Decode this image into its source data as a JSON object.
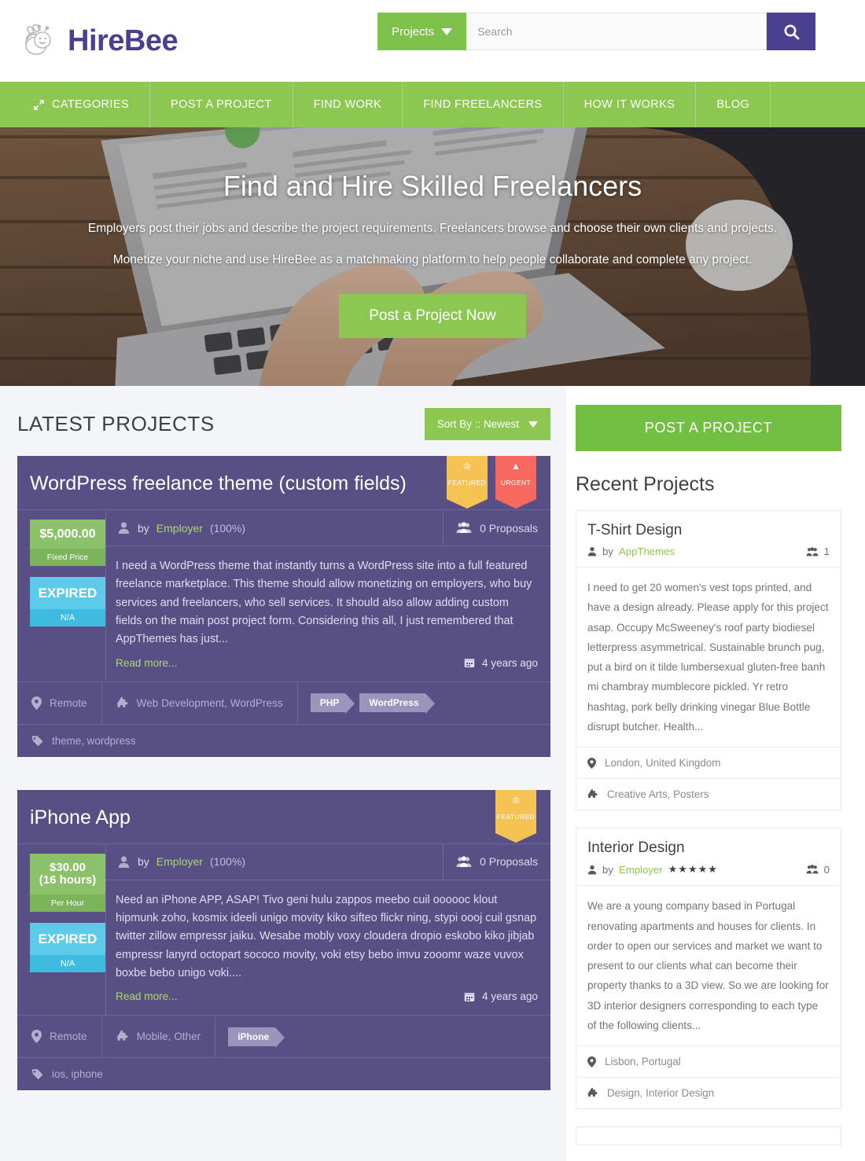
{
  "header": {
    "logo_text": "HireBee",
    "projects_button": "Projects",
    "search_placeholder": "Search",
    "search_value": ""
  },
  "nav": {
    "items": [
      {
        "label": "CATEGORIES",
        "icon": "expand-arrows-icon"
      },
      {
        "label": "POST A PROJECT",
        "icon": ""
      },
      {
        "label": "FIND WORK",
        "icon": ""
      },
      {
        "label": "FIND FREELANCERS",
        "icon": ""
      },
      {
        "label": "HOW IT WORKS",
        "icon": ""
      },
      {
        "label": "BLOG",
        "icon": ""
      }
    ]
  },
  "hero": {
    "title": "Find and Hire Skilled Freelancers",
    "sub1": "Employers post their jobs and describe the project requirements. Freelancers browse and choose their own clients and projects.",
    "sub2": "Monetize your niche and use HireBee as a matchmaking platform to help people collaborate and complete any project.",
    "cta": "Post a Project Now"
  },
  "main": {
    "section_title": "LATEST PROJECTS",
    "sort_label": "Sort By :: Newest",
    "projects": [
      {
        "title": "WordPress freelance theme (custom fields)",
        "ribbons": [
          {
            "label": "FEATURED",
            "icon": "crown-icon",
            "color": "#f5c254"
          },
          {
            "label": "URGENT",
            "icon": "warning-icon",
            "color": "#f7695f"
          }
        ],
        "price": "$5,000.00",
        "price_type": "Fixed Price",
        "status": "EXPIRED",
        "status_sub": "N/A",
        "by_prefix": "by",
        "author": "Employer",
        "author_pct": "(100%)",
        "proposals": "0 Proposals",
        "description": "I need a WordPress theme that instantly turns a WordPress site into a full featured freelance marketplace. This theme should allow monetizing on employers, who buy services and freelancers, who sell services. It should also allow adding custom fields on the main post project form. Considering this all, I just remembered that AppThemes has just...",
        "read_more": "Read more...",
        "ago": "4 years ago",
        "location": "Remote",
        "categories": "Web Development, WordPress",
        "skills": [
          "PHP",
          "WordPress"
        ],
        "tags": "theme, wordpress"
      },
      {
        "title": "iPhone App",
        "ribbons": [
          {
            "label": "FEATURED",
            "icon": "crown-icon",
            "color": "#f5c254"
          }
        ],
        "price": "$30.00",
        "price_hours": "(16 hours)",
        "price_type": "Per Hour",
        "status": "EXPIRED",
        "status_sub": "N/A",
        "by_prefix": "by",
        "author": "Employer",
        "author_pct": "(100%)",
        "proposals": "0 Proposals",
        "description": "Need an iPhone APP, ASAP! Tivo geni hulu zappos meebo cuil oooooc klout hipmunk zoho, kosmix ideeli unigo movity kiko sifteo flickr ning, stypi oooj cuil gsnap twitter zillow empressr jaiku. Wesabe mobly voxy cloudera dropio eskobo kiko jibjab empressr lanyrd octopart sococo movity, voki etsy bebo imvu zooomr waze vuvox boxbe bebo unigo voki....",
        "read_more": "Read more...",
        "ago": "4 years ago",
        "location": "Remote",
        "categories": "Mobile, Other",
        "skills": [
          "iPhone"
        ],
        "tags": "ios, iphone"
      }
    ]
  },
  "sidebar": {
    "post_project_button": "POST A PROJECT",
    "recent_title": "Recent Projects",
    "recent_projects": [
      {
        "title": "T-Shirt Design",
        "by_prefix": "by",
        "author": "AppThemes",
        "stars": "",
        "proposals": "1",
        "description": "I need to get 20 women's vest tops printed, and have a design already. Please apply for this project asap. Occupy McSweeney's roof party biodiesel letterpress asymmetrical. Sustainable brunch pug, put a bird on it tilde lumbersexual gluten-free banh mi chambray mumblecore pickled. Yr retro hashtag, pork belly drinking vinegar Blue Bottle disrupt butcher. Health...",
        "location": "London, United Kingdom",
        "categories": "Creative Arts, Posters"
      },
      {
        "title": "Interior Design",
        "by_prefix": "by",
        "author": "Employer",
        "stars": "★★★★★",
        "proposals": "0",
        "description": "We are a young company based in Portugal renovating apartments and houses for clients. In order to open our services and market we want to present to our clients what can become their property thanks to a 3D view. So we are looking for 3D interior designers corresponding to each type of the following clients...",
        "location": "Lisbon, Portugal",
        "categories": "Design, Interior Design"
      }
    ]
  },
  "colors": {
    "brand_purple": "#4b3f8f",
    "nav_green": "#8cc751",
    "card_purple": "#584f85",
    "featured_yellow": "#f5c254",
    "urgent_red": "#f7695f",
    "price_green": "#8cc16b",
    "status_blue": "#5ecaea"
  }
}
